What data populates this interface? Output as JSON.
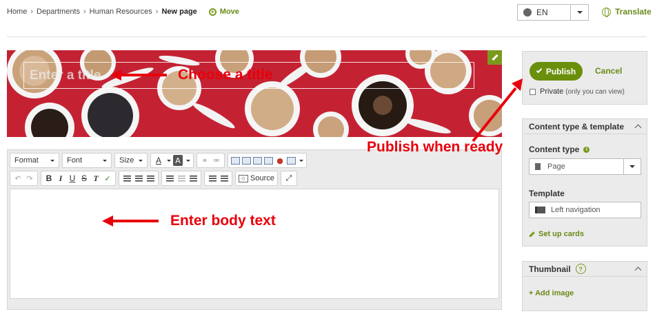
{
  "breadcrumb": {
    "items": [
      "Home",
      "Departments",
      "Human Resources"
    ],
    "separator": "›",
    "current": "New page",
    "move_label": "Move"
  },
  "language": {
    "value": "EN",
    "translate_label": "Translate"
  },
  "banner": {
    "title_placeholder": "Enter a title"
  },
  "toolbar": {
    "format_label": "Format",
    "font_label": "Font",
    "size_label": "Size",
    "source_label": "Source"
  },
  "annotations": {
    "title": "Choose a title",
    "publish": "Publish when ready",
    "body": "Enter body text"
  },
  "publish": {
    "publish_label": "Publish",
    "cancel_label": "Cancel",
    "private_label": "Private",
    "private_hint": "(only you can view)"
  },
  "content_type_panel": {
    "heading": "Content type & template",
    "content_type_label": "Content type",
    "content_type_value": "Page",
    "template_label": "Template",
    "template_value": "Left navigation",
    "cards_link": "Set up cards"
  },
  "thumbnail_panel": {
    "heading": "Thumbnail",
    "help": "?",
    "add_image": "+ Add image"
  },
  "colors": {
    "accent_green": "#6a8f0d",
    "annotation_red": "#e8000b",
    "banner_red": "#c42233"
  }
}
